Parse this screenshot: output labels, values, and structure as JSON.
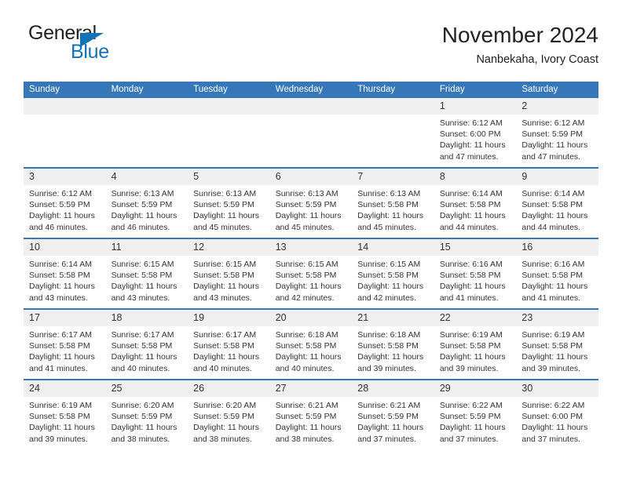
{
  "brand": {
    "name_part1": "General",
    "name_part2": "Blue",
    "logo_icon": "blue-triangle-icon"
  },
  "header": {
    "title": "November 2024",
    "location": "Nanbekaha, Ivory Coast"
  },
  "colors": {
    "header_blue": "#3577b8",
    "daynum_gray": "#efefef",
    "brand_blue": "#1272b6",
    "text": "#333333"
  },
  "calendar": {
    "weekday_headers": [
      "Sunday",
      "Monday",
      "Tuesday",
      "Wednesday",
      "Thursday",
      "Friday",
      "Saturday"
    ],
    "weeks": [
      [
        {
          "day": "",
          "empty": true
        },
        {
          "day": "",
          "empty": true
        },
        {
          "day": "",
          "empty": true
        },
        {
          "day": "",
          "empty": true
        },
        {
          "day": "",
          "empty": true
        },
        {
          "day": "1",
          "sunrise": "Sunrise: 6:12 AM",
          "sunset": "Sunset: 6:00 PM",
          "daylight": "Daylight: 11 hours and 47 minutes."
        },
        {
          "day": "2",
          "sunrise": "Sunrise: 6:12 AM",
          "sunset": "Sunset: 5:59 PM",
          "daylight": "Daylight: 11 hours and 47 minutes."
        }
      ],
      [
        {
          "day": "3",
          "sunrise": "Sunrise: 6:12 AM",
          "sunset": "Sunset: 5:59 PM",
          "daylight": "Daylight: 11 hours and 46 minutes."
        },
        {
          "day": "4",
          "sunrise": "Sunrise: 6:13 AM",
          "sunset": "Sunset: 5:59 PM",
          "daylight": "Daylight: 11 hours and 46 minutes."
        },
        {
          "day": "5",
          "sunrise": "Sunrise: 6:13 AM",
          "sunset": "Sunset: 5:59 PM",
          "daylight": "Daylight: 11 hours and 45 minutes."
        },
        {
          "day": "6",
          "sunrise": "Sunrise: 6:13 AM",
          "sunset": "Sunset: 5:59 PM",
          "daylight": "Daylight: 11 hours and 45 minutes."
        },
        {
          "day": "7",
          "sunrise": "Sunrise: 6:13 AM",
          "sunset": "Sunset: 5:58 PM",
          "daylight": "Daylight: 11 hours and 45 minutes."
        },
        {
          "day": "8",
          "sunrise": "Sunrise: 6:14 AM",
          "sunset": "Sunset: 5:58 PM",
          "daylight": "Daylight: 11 hours and 44 minutes."
        },
        {
          "day": "9",
          "sunrise": "Sunrise: 6:14 AM",
          "sunset": "Sunset: 5:58 PM",
          "daylight": "Daylight: 11 hours and 44 minutes."
        }
      ],
      [
        {
          "day": "10",
          "sunrise": "Sunrise: 6:14 AM",
          "sunset": "Sunset: 5:58 PM",
          "daylight": "Daylight: 11 hours and 43 minutes."
        },
        {
          "day": "11",
          "sunrise": "Sunrise: 6:15 AM",
          "sunset": "Sunset: 5:58 PM",
          "daylight": "Daylight: 11 hours and 43 minutes."
        },
        {
          "day": "12",
          "sunrise": "Sunrise: 6:15 AM",
          "sunset": "Sunset: 5:58 PM",
          "daylight": "Daylight: 11 hours and 43 minutes."
        },
        {
          "day": "13",
          "sunrise": "Sunrise: 6:15 AM",
          "sunset": "Sunset: 5:58 PM",
          "daylight": "Daylight: 11 hours and 42 minutes."
        },
        {
          "day": "14",
          "sunrise": "Sunrise: 6:15 AM",
          "sunset": "Sunset: 5:58 PM",
          "daylight": "Daylight: 11 hours and 42 minutes."
        },
        {
          "day": "15",
          "sunrise": "Sunrise: 6:16 AM",
          "sunset": "Sunset: 5:58 PM",
          "daylight": "Daylight: 11 hours and 41 minutes."
        },
        {
          "day": "16",
          "sunrise": "Sunrise: 6:16 AM",
          "sunset": "Sunset: 5:58 PM",
          "daylight": "Daylight: 11 hours and 41 minutes."
        }
      ],
      [
        {
          "day": "17",
          "sunrise": "Sunrise: 6:17 AM",
          "sunset": "Sunset: 5:58 PM",
          "daylight": "Daylight: 11 hours and 41 minutes."
        },
        {
          "day": "18",
          "sunrise": "Sunrise: 6:17 AM",
          "sunset": "Sunset: 5:58 PM",
          "daylight": "Daylight: 11 hours and 40 minutes."
        },
        {
          "day": "19",
          "sunrise": "Sunrise: 6:17 AM",
          "sunset": "Sunset: 5:58 PM",
          "daylight": "Daylight: 11 hours and 40 minutes."
        },
        {
          "day": "20",
          "sunrise": "Sunrise: 6:18 AM",
          "sunset": "Sunset: 5:58 PM",
          "daylight": "Daylight: 11 hours and 40 minutes."
        },
        {
          "day": "21",
          "sunrise": "Sunrise: 6:18 AM",
          "sunset": "Sunset: 5:58 PM",
          "daylight": "Daylight: 11 hours and 39 minutes."
        },
        {
          "day": "22",
          "sunrise": "Sunrise: 6:19 AM",
          "sunset": "Sunset: 5:58 PM",
          "daylight": "Daylight: 11 hours and 39 minutes."
        },
        {
          "day": "23",
          "sunrise": "Sunrise: 6:19 AM",
          "sunset": "Sunset: 5:58 PM",
          "daylight": "Daylight: 11 hours and 39 minutes."
        }
      ],
      [
        {
          "day": "24",
          "sunrise": "Sunrise: 6:19 AM",
          "sunset": "Sunset: 5:58 PM",
          "daylight": "Daylight: 11 hours and 39 minutes."
        },
        {
          "day": "25",
          "sunrise": "Sunrise: 6:20 AM",
          "sunset": "Sunset: 5:59 PM",
          "daylight": "Daylight: 11 hours and 38 minutes."
        },
        {
          "day": "26",
          "sunrise": "Sunrise: 6:20 AM",
          "sunset": "Sunset: 5:59 PM",
          "daylight": "Daylight: 11 hours and 38 minutes."
        },
        {
          "day": "27",
          "sunrise": "Sunrise: 6:21 AM",
          "sunset": "Sunset: 5:59 PM",
          "daylight": "Daylight: 11 hours and 38 minutes."
        },
        {
          "day": "28",
          "sunrise": "Sunrise: 6:21 AM",
          "sunset": "Sunset: 5:59 PM",
          "daylight": "Daylight: 11 hours and 37 minutes."
        },
        {
          "day": "29",
          "sunrise": "Sunrise: 6:22 AM",
          "sunset": "Sunset: 5:59 PM",
          "daylight": "Daylight: 11 hours and 37 minutes."
        },
        {
          "day": "30",
          "sunrise": "Sunrise: 6:22 AM",
          "sunset": "Sunset: 6:00 PM",
          "daylight": "Daylight: 11 hours and 37 minutes."
        }
      ]
    ]
  }
}
